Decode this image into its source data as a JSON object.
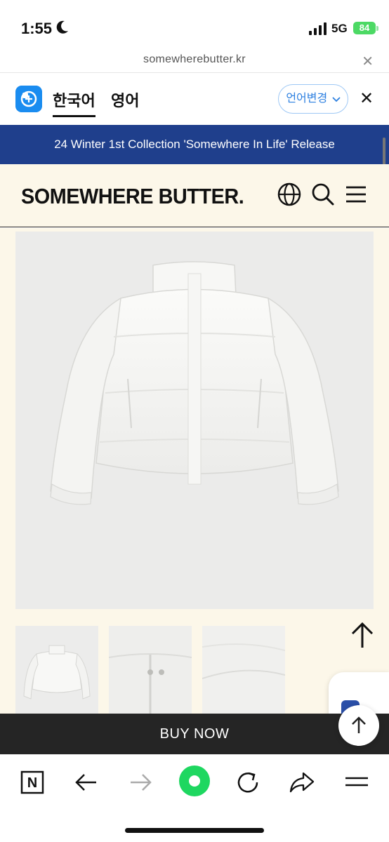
{
  "status_bar": {
    "time": "1:55",
    "network": "5G",
    "battery": "84"
  },
  "url_bar": {
    "url": "somewherebutter.kr",
    "close_label": "✕"
  },
  "translate_bar": {
    "language_korean": "한국어",
    "language_english": "영어",
    "change_language": "언어변경",
    "close_label": "✕"
  },
  "banner": {
    "text": "24 Winter 1st Collection 'Somewhere In Life' Release"
  },
  "site_header": {
    "logo": "SOMEWHERE BUTTER."
  },
  "buy_now": {
    "label": "BUY NOW"
  },
  "toolbar": {
    "tab_label": "N"
  },
  "colors": {
    "banner_bg": "#1f3f8c",
    "header_bg": "#fcf7e9",
    "buy_bg": "#252525",
    "accent_green": "#1ed760",
    "battery_green": "#4cd964"
  }
}
